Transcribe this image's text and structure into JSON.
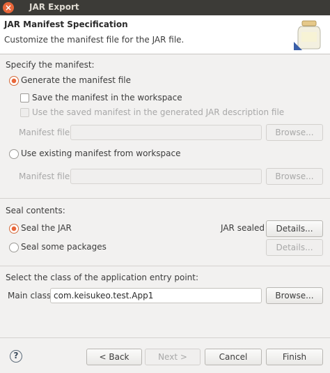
{
  "window": {
    "title": "JAR Export"
  },
  "header": {
    "title": "JAR Manifest Specification",
    "description": "Customize the manifest file for the JAR file."
  },
  "manifest_section": {
    "label": "Specify the manifest:",
    "generate_radio": {
      "label": "Generate the manifest file",
      "checked": true
    },
    "save_check": {
      "label": "Save the manifest in the workspace",
      "checked": false
    },
    "use_saved_check": {
      "label": "Use the saved manifest in the generated JAR description file",
      "checked": false,
      "enabled": false
    },
    "manifest_file_label_1": "Manifest file:",
    "manifest_file_value_1": "",
    "browse_1": "Browse...",
    "existing_radio": {
      "label": "Use existing manifest from workspace",
      "checked": false
    },
    "manifest_file_label_2": "Manifest file:",
    "manifest_file_value_2": "",
    "browse_2": "Browse..."
  },
  "seal_section": {
    "label": "Seal contents:",
    "seal_jar_radio": {
      "label": "Seal the JAR",
      "checked": true
    },
    "jar_sealed_label": "JAR sealed",
    "details_1": "Details...",
    "seal_packages_radio": {
      "label": "Seal some packages",
      "checked": false
    },
    "details_2": "Details..."
  },
  "entry_section": {
    "label": "Select the class of the application entry point:",
    "main_class_label": "Main class:",
    "main_class_value": "com.keisukeo.test.App1",
    "browse": "Browse..."
  },
  "footer": {
    "help_icon": "help-icon",
    "back": "< Back",
    "next": "Next >",
    "cancel": "Cancel",
    "finish": "Finish"
  }
}
